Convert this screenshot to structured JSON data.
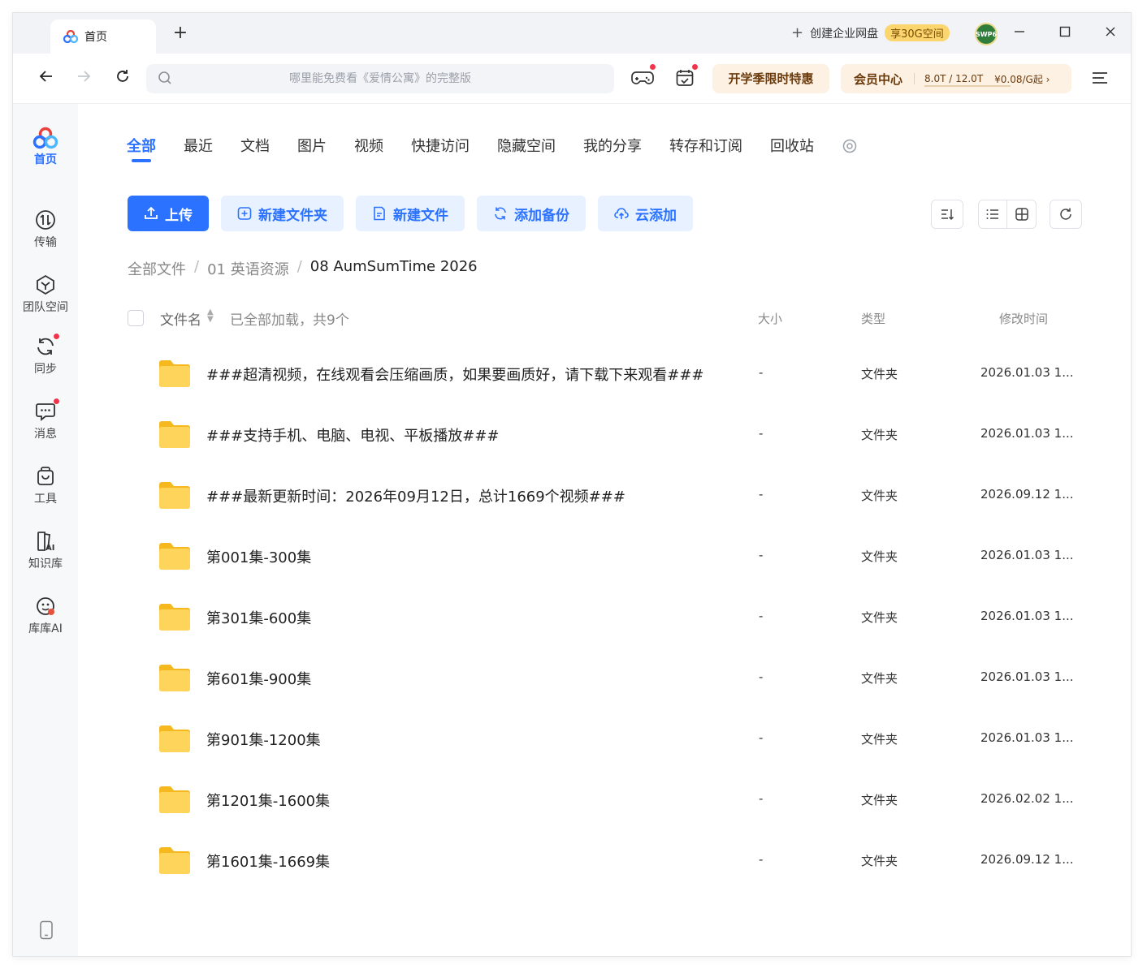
{
  "titlebar": {
    "tab_label": "首页",
    "new_tab": "+",
    "enterprise_label": "创建企业网盘",
    "enterprise_promo": "享30G空间",
    "avatar_text": "SWP6"
  },
  "navbar": {
    "search_placeholder": "哪里能免费看《爱情公寓》的完整版",
    "promo_label": "开学季限时特惠",
    "vip_label": "会员中心",
    "quota": "8.0T / 12.0T",
    "quota_used_fraction": 0.67,
    "price": "¥0.08/G起 ›"
  },
  "sidebar": {
    "items": [
      {
        "label": "首页",
        "icon": "cloud-logo-icon"
      },
      {
        "label": "传输",
        "icon": "transfer-icon"
      },
      {
        "label": "团队空间",
        "icon": "team-space-icon"
      },
      {
        "label": "同步",
        "icon": "sync-icon"
      },
      {
        "label": "消息",
        "icon": "message-icon"
      },
      {
        "label": "工具",
        "icon": "tools-icon"
      },
      {
        "label": "知识库",
        "icon": "knowledge-base-icon"
      },
      {
        "label": "库库AI",
        "icon": "kuku-ai-icon"
      }
    ]
  },
  "tabs": [
    "全部",
    "最近",
    "文档",
    "图片",
    "视频",
    "快捷访问",
    "隐藏空间",
    "我的分享",
    "转存和订阅",
    "回收站"
  ],
  "actions": {
    "upload": "上传",
    "new_folder": "新建文件夹",
    "new_file": "新建文件",
    "add_backup": "添加备份",
    "cloud_add": "云添加"
  },
  "breadcrumb": {
    "root": "全部文件",
    "parent": "01 英语资源",
    "current": "08 AumSumTime 2026",
    "sep": "/"
  },
  "table": {
    "col_name": "文件名",
    "loaded_note": "已全部加载，共9个",
    "col_size": "大小",
    "col_type": "类型",
    "col_mtime": "修改时间",
    "rows": [
      {
        "name": "###超清视频，在线观看会压缩画质，如果要画质好，请下载下来观看###",
        "size": "-",
        "type": "文件夹",
        "mtime": "2026.01.03 1..."
      },
      {
        "name": "###支持手机、电脑、电视、平板播放###",
        "size": "-",
        "type": "文件夹",
        "mtime": "2026.01.03 1..."
      },
      {
        "name": "###最新更新时间：2026年09月12日，总计1669个视频###",
        "size": "-",
        "type": "文件夹",
        "mtime": "2026.09.12 1..."
      },
      {
        "name": "第001集-300集",
        "size": "-",
        "type": "文件夹",
        "mtime": "2026.01.03 1..."
      },
      {
        "name": "第301集-600集",
        "size": "-",
        "type": "文件夹",
        "mtime": "2026.01.03 1..."
      },
      {
        "name": "第601集-900集",
        "size": "-",
        "type": "文件夹",
        "mtime": "2026.01.03 1..."
      },
      {
        "name": "第901集-1200集",
        "size": "-",
        "type": "文件夹",
        "mtime": "2026.01.03 1..."
      },
      {
        "name": "第1201集-1600集",
        "size": "-",
        "type": "文件夹",
        "mtime": "2026.02.02 1..."
      },
      {
        "name": "第1601集-1669集",
        "size": "-",
        "type": "文件夹",
        "mtime": "2026.09.12 1..."
      }
    ]
  },
  "colors": {
    "accent": "#2a72ff",
    "folder": "#ffc53d",
    "badge": "#f0344b",
    "vip_text": "#6b3a0a"
  }
}
